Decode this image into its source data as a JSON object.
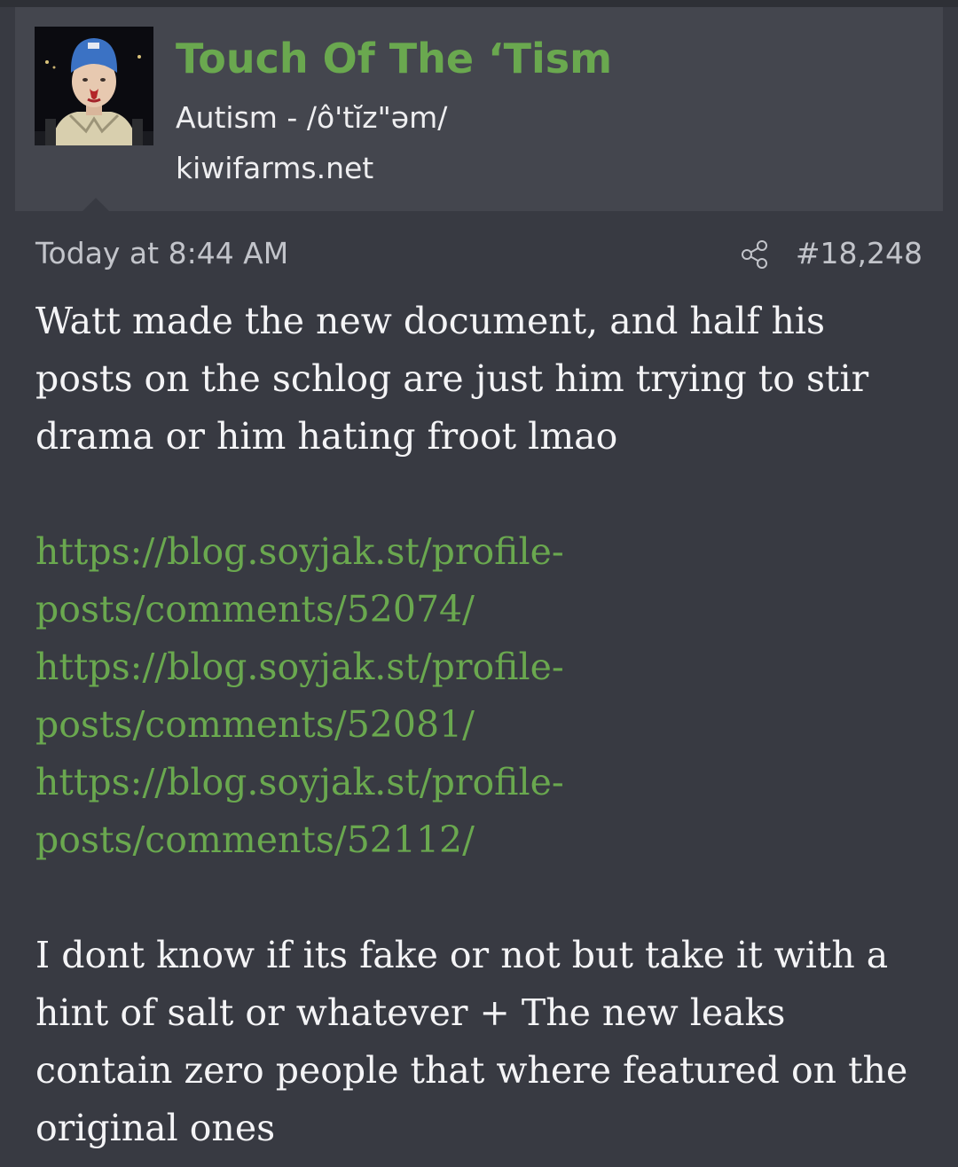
{
  "user": {
    "name": "Touch Of The ‘Tism",
    "title": "Autism - /ô'tĭz\"əm/",
    "site": "kiwifarms.net"
  },
  "post": {
    "timestamp": "Today at 8:44 AM",
    "number": "#18,248",
    "paragraph1": "Watt made the new document, and half his posts on the schlog are just him trying to stir drama or him hating froot lmao",
    "links": [
      {
        "line1": "https://blog.soyjak.st/profile-",
        "line2": "posts/comments/52074/"
      },
      {
        "line1": "https://blog.soyjak.st/profile-",
        "line2": "posts/comments/52081/"
      },
      {
        "line1": "https://blog.soyjak.st/profile-",
        "line2": "posts/comments/52112/"
      }
    ],
    "paragraph2": "I dont know if its fake or not but take it with a hint of salt or whatever + The new leaks contain zero people that where featured on the original ones"
  },
  "icons": {
    "share": "share-icon"
  },
  "colors": {
    "accent": "#6aa84f",
    "background": "#383a42",
    "header": "#44464e",
    "text": "#f4f4f6",
    "muted": "#c2c4ca"
  }
}
